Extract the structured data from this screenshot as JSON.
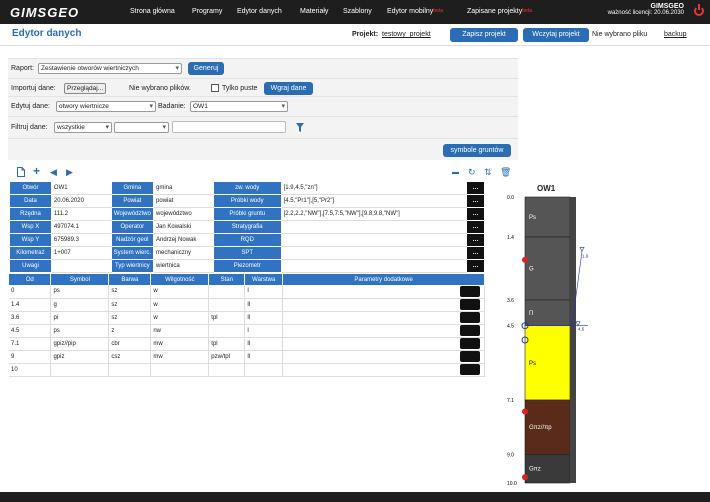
{
  "topbar": {
    "logo": "GIMSGEO",
    "nav": [
      "Strona główna",
      "Programy",
      "Edytor danych",
      "Materiały",
      "Szablony",
      "Edytor mobilny",
      "Zapisane projekty"
    ],
    "beta": "beta",
    "user": "GIMSGEO",
    "license": "ważność licencji: 20.06.2030"
  },
  "header": {
    "title": "Edytor danych",
    "project_label": "Projekt:",
    "project_name": "testowy_projekt",
    "save": "Zapisz projekt",
    "load": "Wczytaj projekt",
    "no_file": "Nie wybrano pliku",
    "backup": "backup"
  },
  "report": {
    "label": "Raport:",
    "value": "Zestawienie otworów wiertniczych",
    "generate": "Generuj"
  },
  "import": {
    "label": "Importuj dane:",
    "browse": "Przeglądaj...",
    "no_files": "Nie wybrano plików.",
    "only_empty": "Tylko puste",
    "upload": "Wgraj dane"
  },
  "edit": {
    "label": "Edytuj dane:",
    "value": "otwory wiertnicze",
    "study_label": "Badanie:",
    "study": "OW1"
  },
  "filter": {
    "label": "Filtruj dane:",
    "value": "wszystkie"
  },
  "soil_symbols": "symbole gruntów",
  "info": [
    [
      "Otwór",
      "OW1",
      "Gmina",
      "gmina",
      "zw. wody",
      "[1.9,4.5,\"zn\"]"
    ],
    [
      "Data",
      "20.06.2020",
      "Powiat",
      "powiat",
      "Próbki wody",
      "[4.5,\"Pr1\"],[5,\"Pr2\"]"
    ],
    [
      "Rzędna",
      "111.2",
      "Województwo",
      "województwo",
      "Próbki gruntu",
      "[2.2,2.2,\"NW\"],[7.5,7.5,\"NW\"],[9.8,9.8,\"NW\"]"
    ],
    [
      "Wsp X",
      "497074.1",
      "Operator",
      "Jan Kowalski",
      "Stratygrafia",
      ""
    ],
    [
      "Wsp Y",
      "675989.3",
      "Nadzór geol",
      "Andrzej Nowak",
      "RQD",
      ""
    ],
    [
      "Kilometraż",
      "1+007",
      "System wierc.",
      "mechaniczny",
      "SPT",
      ""
    ],
    [
      "Uwagi",
      "",
      "Typ wiertnicy",
      "wiertnica",
      "Piezometr",
      ""
    ]
  ],
  "layers_header": [
    "Od",
    "Symbol",
    "Barwa",
    "Wilgotność",
    "Stan",
    "Warstwa",
    "Parametry dodatkowe"
  ],
  "layers": [
    [
      "0",
      "ps",
      "sz",
      "w",
      "",
      "I"
    ],
    [
      "1.4",
      "g",
      "sz",
      "w",
      "",
      "II"
    ],
    [
      "3.6",
      "pi",
      "sz",
      "w",
      "tpl",
      "II"
    ],
    [
      "4.5",
      "ps",
      "z",
      "nw",
      "",
      "I"
    ],
    [
      "7.1",
      "gpiz//pip",
      "cbr",
      "mw",
      "tpl",
      "II"
    ],
    [
      "9",
      "gpiz",
      "csz",
      "mw",
      "pzw/tpl",
      "II"
    ],
    [
      "10",
      "",
      "",
      "",
      "",
      ""
    ]
  ],
  "column": {
    "title": "OW1",
    "depths": [
      "0.0",
      "1.4",
      "3.6",
      "4.5",
      "7.1",
      "9.0",
      "10.0"
    ],
    "layer_labels": [
      "Ps",
      "G",
      "Π",
      "Ps",
      "Gπz//πp",
      "Gπz"
    ],
    "water": [
      "1.9",
      "4.5"
    ],
    "colors": [
      "#555555",
      "#555555",
      "#555555",
      "#ffff00",
      "#5a2a1a",
      "#3a3a3a"
    ]
  }
}
